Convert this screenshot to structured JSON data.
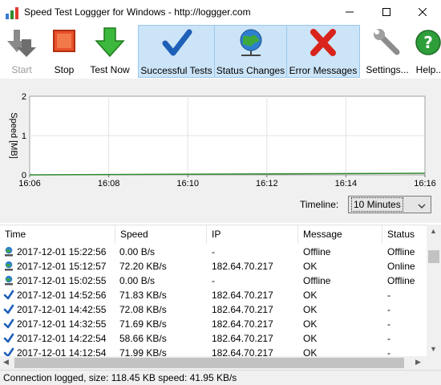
{
  "window": {
    "title": "Speed Test Loggger for Windows - http://loggger.com",
    "icon": "speed-logger-app-icon",
    "controls": [
      "minimize-icon",
      "maximize-icon",
      "close-icon"
    ]
  },
  "toolbar": {
    "start": {
      "label": "Start",
      "icon": "arrow-down-right-icon",
      "enabled": false
    },
    "stop": {
      "label": "Stop",
      "icon": "stop-square-icon"
    },
    "test_now": {
      "label": "Test Now",
      "icon": "green-arrow-down-icon"
    },
    "successful_tests": {
      "label": "Successful Tests",
      "icon": "checkmark-icon",
      "active": true
    },
    "status_changes": {
      "label": "Status Changes",
      "icon": "globe-network-icon",
      "active": true
    },
    "error_messages": {
      "label": "Error Messages",
      "icon": "red-x-icon",
      "active": true
    },
    "settings": {
      "label": "Settings...",
      "icon": "wrench-icon"
    },
    "help": {
      "label": "Help...",
      "icon": "help-question-icon"
    }
  },
  "chart_data": {
    "type": "line",
    "ylabel": "Speed [MB]",
    "ylim": [
      0,
      2
    ],
    "yticks": [
      "0",
      "1",
      "2"
    ],
    "xticks": [
      "16:06",
      "16:08",
      "16:10",
      "16:12",
      "16:14",
      "16:16"
    ],
    "series": [
      {
        "color": "#2e8b2e",
        "x": [
          "16:06",
          "16:16"
        ],
        "values": [
          0.0,
          0.04
        ]
      }
    ],
    "grid": true
  },
  "timeline": {
    "label": "Timeline:",
    "selected": "10 Minutes"
  },
  "table": {
    "columns": [
      "Time",
      "Speed",
      "IP",
      "Message",
      "Status"
    ],
    "rows": [
      {
        "icon": "user-globe-icon",
        "time": "2017-12-01 15:22:56",
        "speed": "0.00 B/s",
        "ip": "-",
        "message": "Offline",
        "status": "Offline"
      },
      {
        "icon": "user-globe-icon",
        "time": "2017-12-01 15:12:57",
        "speed": "72.20 KB/s",
        "ip": "182.64.70.217",
        "message": "OK",
        "status": "Online"
      },
      {
        "icon": "user-globe-icon",
        "time": "2017-12-01 15:02:55",
        "speed": "0.00 B/s",
        "ip": "-",
        "message": "Offline",
        "status": "Offline"
      },
      {
        "icon": "checkmark-icon",
        "time": "2017-12-01 14:52:56",
        "speed": "71.83 KB/s",
        "ip": "182.64.70.217",
        "message": "OK",
        "status": "-"
      },
      {
        "icon": "checkmark-icon",
        "time": "2017-12-01 14:42:55",
        "speed": "72.08 KB/s",
        "ip": "182.64.70.217",
        "message": "OK",
        "status": "-"
      },
      {
        "icon": "checkmark-icon",
        "time": "2017-12-01 14:32:55",
        "speed": "71.69 KB/s",
        "ip": "182.64.70.217",
        "message": "OK",
        "status": "-"
      },
      {
        "icon": "checkmark-icon",
        "time": "2017-12-01 14:22:54",
        "speed": "58.66 KB/s",
        "ip": "182.64.70.217",
        "message": "OK",
        "status": "-"
      },
      {
        "icon": "checkmark-icon",
        "time": "2017-12-01 14:12:54",
        "speed": "71.99 KB/s",
        "ip": "182.64.70.217",
        "message": "OK",
        "status": "-"
      }
    ]
  },
  "statusbar": {
    "text": "Connection logged, size: 118.45 KB speed: 41.95 KB/s"
  },
  "colors": {
    "active_toggle": "#cce4f7",
    "active_border": "#99c9ef",
    "chart_line": "#2e8b2e"
  }
}
